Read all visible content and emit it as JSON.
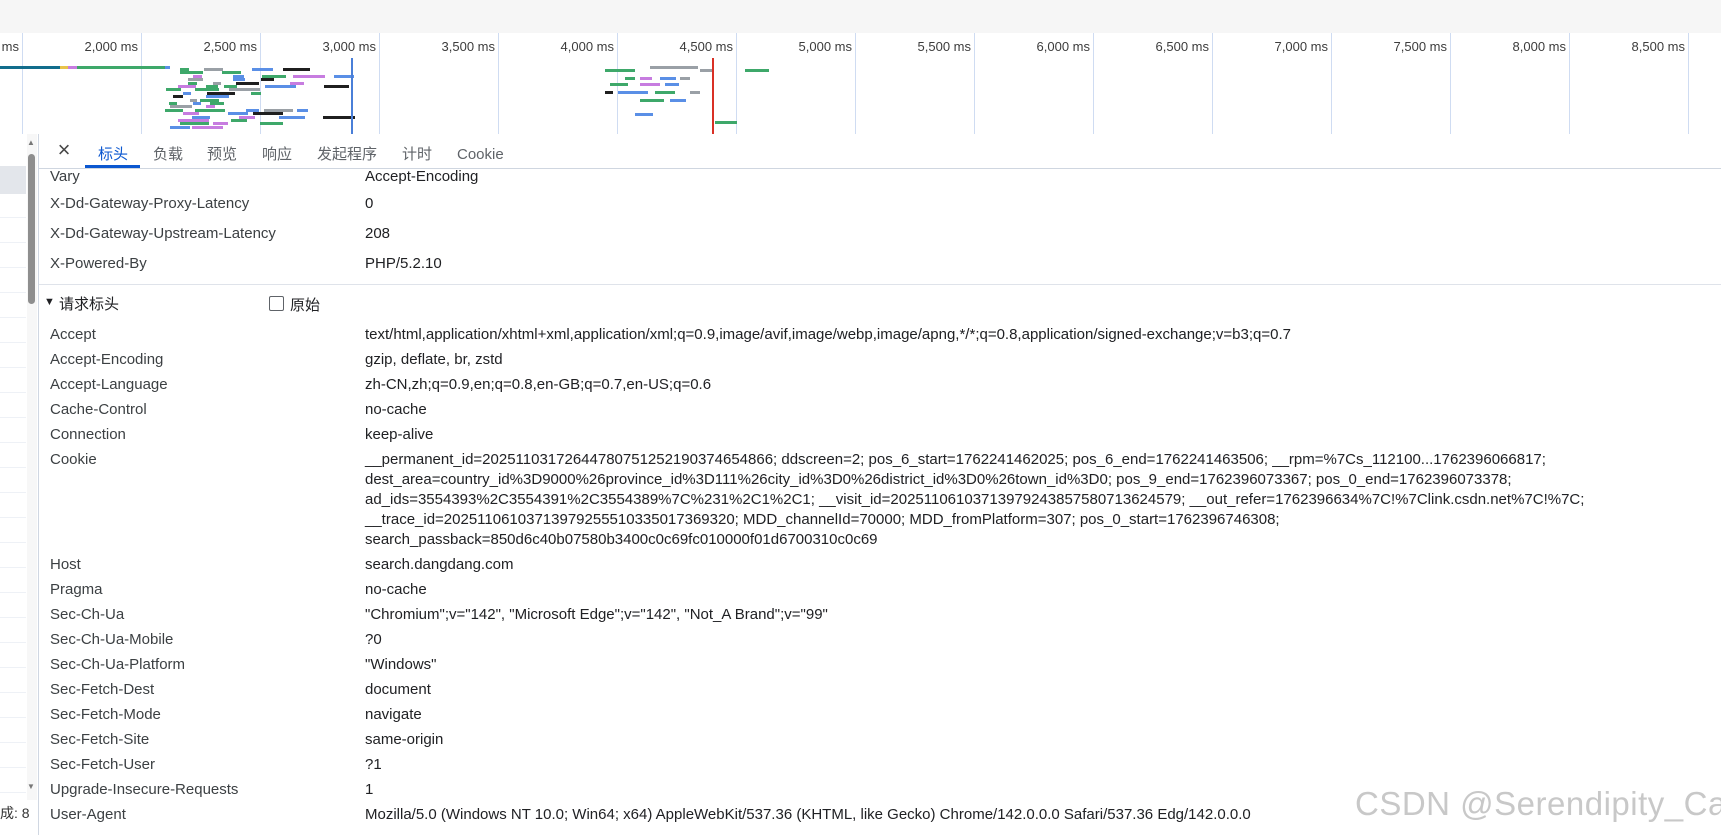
{
  "timeline": {
    "ticks": [
      "ms",
      "2,000 ms",
      "2,500 ms",
      "3,000 ms",
      "3,500 ms",
      "4,000 ms",
      "4,500 ms",
      "5,000 ms",
      "5,500 ms",
      "6,000 ms",
      "6,500 ms",
      "7,000 ms",
      "7,500 ms",
      "8,000 ms",
      "8,500 ms"
    ],
    "colors": {
      "green": "#3ea86a",
      "blue": "#5a8fe6",
      "gray": "#9aa0a6",
      "purple": "#c77ce0",
      "black": "#1f1f1f",
      "teal": "#126d8c",
      "yellow": "#e8c44a",
      "blue_marker": "#4a7fd8",
      "red_marker": "#d93025"
    }
  },
  "left_pane": {
    "status_text": "成: 8"
  },
  "tabs": {
    "close_icon": "×",
    "items": [
      "标头",
      "负载",
      "预览",
      "响应",
      "发起程序",
      "计时",
      "Cookie"
    ],
    "active": "标头"
  },
  "response_headers_tail": [
    {
      "name": "Vary",
      "value": "Accept-Encoding"
    },
    {
      "name": "X-Dd-Gateway-Proxy-Latency",
      "value": "0"
    },
    {
      "name": "X-Dd-Gateway-Upstream-Latency",
      "value": "208"
    },
    {
      "name": "X-Powered-By",
      "value": "PHP/5.2.10"
    }
  ],
  "request_section": {
    "triangle": "▼",
    "title": "请求标头",
    "raw_label": "原始",
    "raw_checked": false
  },
  "request_headers": [
    {
      "name": "Accept",
      "value": "text/html,application/xhtml+xml,application/xml;q=0.9,image/avif,image/webp,image/apng,*/*;q=0.8,application/signed-exchange;v=b3;q=0.7"
    },
    {
      "name": "Accept-Encoding",
      "value": "gzip, deflate, br, zstd"
    },
    {
      "name": "Accept-Language",
      "value": "zh-CN,zh;q=0.9,en;q=0.8,en-GB;q=0.7,en-US;q=0.6"
    },
    {
      "name": "Cache-Control",
      "value": "no-cache"
    },
    {
      "name": "Connection",
      "value": "keep-alive"
    },
    {
      "name": "Cookie",
      "lines": [
        "__permanent_id=20251103172644780751252190374654866; ddscreen=2; pos_6_start=1762241462025; pos_6_end=1762241463506; __rpm=%7Cs_112100...1762396066817;",
        "dest_area=country_id%3D9000%26province_id%3D111%26city_id%3D0%26district_id%3D0%26town_id%3D0; pos_9_end=1762396073367; pos_0_end=1762396073378;",
        "ad_ids=3554393%2C3554391%2C3554389%7C%231%2C1%2C1; __visit_id=20251106103713979243857580713624579; __out_refer=1762396634%7C!%7Clink.csdn.net%7C!%7C;",
        "__trace_id=20251106103713979255510335017369320; MDD_channelId=70000; MDD_fromPlatform=307; pos_0_start=1762396746308;",
        "search_passback=850d6c40b07580b3400c0c69fc010000f01d6700310c0c69"
      ]
    },
    {
      "name": "Host",
      "value": "search.dangdang.com"
    },
    {
      "name": "Pragma",
      "value": "no-cache"
    },
    {
      "name": "Sec-Ch-Ua",
      "value": "\"Chromium\";v=\"142\", \"Microsoft Edge\";v=\"142\", \"Not_A Brand\";v=\"99\""
    },
    {
      "name": "Sec-Ch-Ua-Mobile",
      "value": "?0"
    },
    {
      "name": "Sec-Ch-Ua-Platform",
      "value": "\"Windows\""
    },
    {
      "name": "Sec-Fetch-Dest",
      "value": "document"
    },
    {
      "name": "Sec-Fetch-Mode",
      "value": "navigate"
    },
    {
      "name": "Sec-Fetch-Site",
      "value": "same-origin"
    },
    {
      "name": "Sec-Fetch-User",
      "value": "?1"
    },
    {
      "name": "Upgrade-Insecure-Requests",
      "value": "1"
    },
    {
      "name": "User-Agent",
      "value": "Mozilla/5.0 (Windows NT 10.0; Win64; x64) AppleWebKit/537.36 (KHTML, like Gecko) Chrome/142.0.0.0 Safari/537.36 Edg/142.0.0.0"
    }
  ],
  "watermark": "CSDN @Serendipity_Carl"
}
